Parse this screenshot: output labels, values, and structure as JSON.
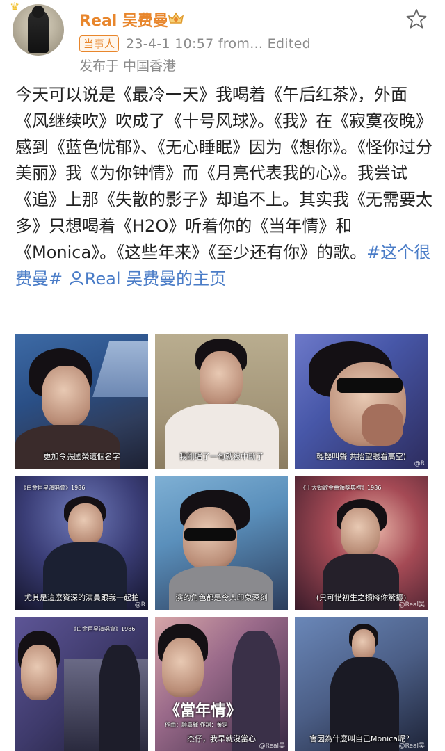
{
  "header": {
    "username": "Real 吴费曼",
    "tag": "当事人",
    "meta": "23-4-1 10:57  from...  Edited",
    "location": "发布于 中国香港"
  },
  "post": {
    "text": "今天可以说是《最冷一天》我喝着《午后红茶》，外面《风继续吹》吹成了《十号风球》。《我》在《寂寞夜晚》感到《蓝色忧郁》、《无心睡眠》因为《想你》。《怪你过分美丽》我《为你钟情》而《月亮代表我的心》。我尝试《追》上那《失散的影子》却追不上。其实我《无需要太多》只想喝着《H2O》听着你的《当年情》和《Monica》。《这些年来》《至少还有你》的歌。",
    "hashtag": "#这个很费曼#",
    "user_link": "Real 吴费曼的主页"
  },
  "images": {
    "img1": {
      "subtitle": "更加令張國榮這個名字"
    },
    "img2": {
      "subtitle": "我剛唱了一句就被中斷了"
    },
    "img3": {
      "subtitle": "輕輕叫聲  共抬望眼看高空)",
      "watermark": "@R"
    },
    "img4": {
      "logo": "《白金巨星演唱會》1986",
      "subtitle": "尤其是這麼資深的演員跟我一起拍",
      "watermark": "@R"
    },
    "img5": {
      "subtitle": "演的角色都是令人印象深刻"
    },
    "img6": {
      "logo": "《十大勁歌金曲頒獎典禮》1986",
      "subtitle": "(只可惜初生之犢將你驚擾)",
      "watermark": "@Real吴"
    },
    "img7": {
      "logo": "《白金巨星演唱會》1986"
    },
    "img8": {
      "title": "《當年情》",
      "credit": "作曲：顧嘉輝  作詞：黃霑",
      "subtitle": "杰仔，我早就沒當心",
      "watermark": "@Real吴"
    },
    "img9": {
      "subtitle": "會因為什麼叫自己Monica呢？",
      "watermark": "@Real吴"
    }
  }
}
